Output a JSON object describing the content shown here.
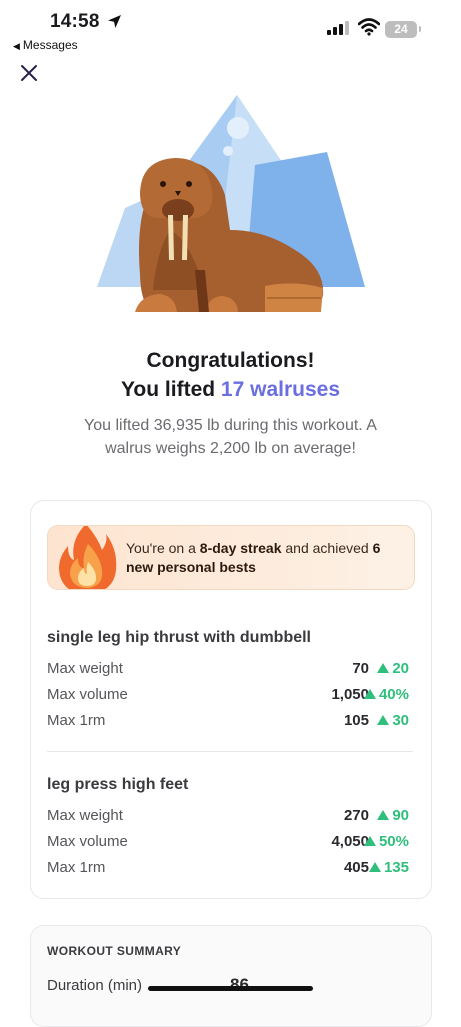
{
  "status_bar": {
    "time": "14:58",
    "back_label": "Messages",
    "battery": "24"
  },
  "hero": {
    "icon": "walrus-on-iceberg-illustration"
  },
  "headline": {
    "line1": "Congratulations!",
    "line2_prefix": "You lifted ",
    "line2_accent": "17 walruses",
    "accent_color": "#6b6ee0"
  },
  "subtext": "You lifted 36,935 lb during this workout. A walrus weighs 2,200 lb on average!",
  "streak": {
    "prefix": "You're on a ",
    "streak_bold": "8-day streak",
    "middle": " and achieved ",
    "pb_bold": "6 new personal bests",
    "icon": "flame-icon"
  },
  "exercises": [
    {
      "name": "single leg hip thrust with dumbbell",
      "rows": [
        {
          "label": "Max weight",
          "value": "70",
          "delta": "20"
        },
        {
          "label": "Max volume",
          "value": "1,050",
          "delta": "40%"
        },
        {
          "label": "Max 1rm",
          "value": "105",
          "delta": "30"
        }
      ]
    },
    {
      "name": "leg press high feet",
      "rows": [
        {
          "label": "Max weight",
          "value": "270",
          "delta": "90"
        },
        {
          "label": "Max volume",
          "value": "4,050",
          "delta": "50%"
        },
        {
          "label": "Max 1rm",
          "value": "405",
          "delta": "135"
        }
      ]
    }
  ],
  "summary": {
    "title": "WORKOUT SUMMARY",
    "duration_label": "Duration (min)",
    "duration_value": "86"
  },
  "colors": {
    "positive": "#2fbf7d",
    "streak_bg": "#fde4d0"
  }
}
